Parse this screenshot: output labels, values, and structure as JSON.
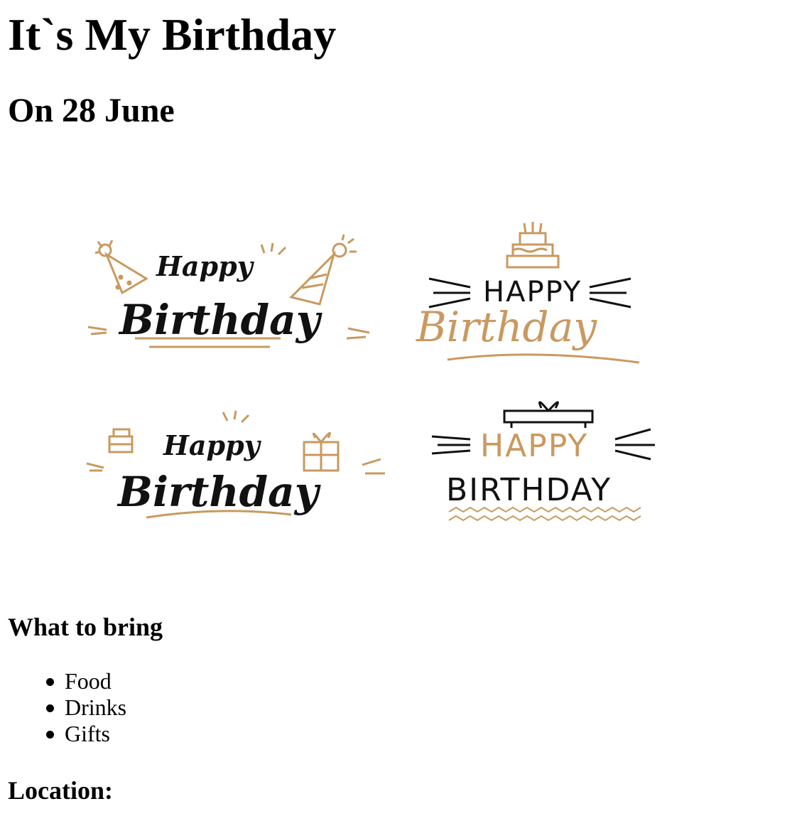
{
  "page": {
    "title": "It`s My Birthday",
    "date": "On 28 June"
  },
  "banner": {
    "items": [
      {
        "line1": "Happy",
        "line2": "Birthday"
      },
      {
        "line1": "HAPPY",
        "line2": "Birthday"
      },
      {
        "line1": "Happy",
        "line2": "Birthday"
      },
      {
        "line1": "HAPPY",
        "line2": "BIRTHDAY"
      }
    ],
    "colors": {
      "gold": "#c9995f",
      "black": "#111111"
    }
  },
  "bring": {
    "heading": "What to bring",
    "items": [
      "Food",
      "Drinks",
      "Gifts"
    ]
  },
  "location": {
    "heading": "Location:"
  }
}
